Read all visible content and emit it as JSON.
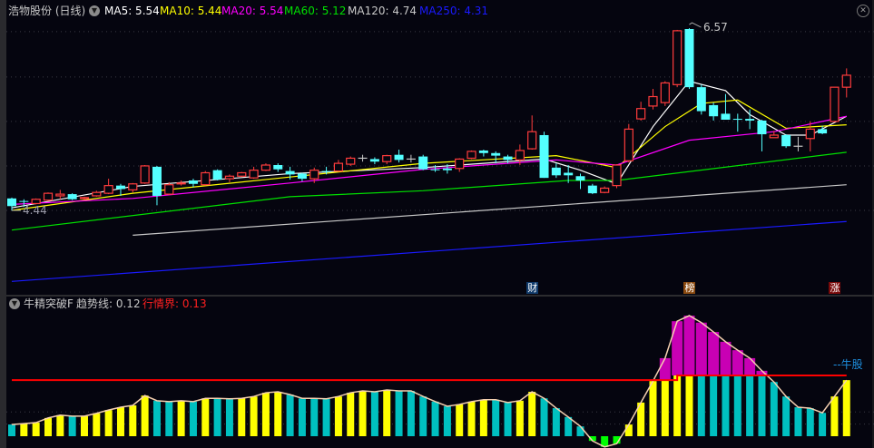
{
  "header": {
    "title": "浩物股份 (日线)",
    "ma": [
      {
        "label": "MA5: 5.54",
        "color": "#ffffff"
      },
      {
        "label": "MA10: 5.44",
        "color": "#ffff00"
      },
      {
        "label": "MA20: 5.54",
        "color": "#ff00ff"
      },
      {
        "label": "MA60: 5.12",
        "color": "#00e000"
      },
      {
        "label": "MA120: 4.74",
        "color": "#c8c8c8"
      },
      {
        "label": "MA250: 4.31",
        "color": "#1a1aff"
      }
    ]
  },
  "indicator_header": {
    "name": "牛精突破F",
    "trend_label": "趋势线: 0.12",
    "market_label": "行情界: 0.13"
  },
  "badges": [
    {
      "label": "财",
      "index": 43,
      "color": "#103a6a"
    },
    {
      "label": "榜",
      "index": 56,
      "color": "#8a4a10"
    },
    {
      "label": "涨",
      "index": 68,
      "color": "#7a0a0a"
    }
  ],
  "annotations": {
    "high_label": "6.57",
    "low_label": "4.44",
    "bull_label": "--牛股"
  },
  "icons": {
    "chevron": "chevron-down-icon",
    "close": "close-icon"
  },
  "chart_data": [
    {
      "type": "candlestick",
      "title": "浩物股份 (日线)",
      "ylim": [
        3.55,
        6.65
      ],
      "grid_prices": [
        4.44,
        4.96,
        5.48,
        6.0,
        6.53
      ],
      "ohlc": [
        [
          4.58,
          4.59,
          4.44,
          4.49
        ],
        [
          4.55,
          4.57,
          4.48,
          4.54
        ],
        [
          4.52,
          4.58,
          4.51,
          4.57
        ],
        [
          4.56,
          4.65,
          4.55,
          4.64
        ],
        [
          4.61,
          4.68,
          4.57,
          4.63
        ],
        [
          4.63,
          4.64,
          4.56,
          4.57
        ],
        [
          4.58,
          4.6,
          4.56,
          4.59
        ],
        [
          4.61,
          4.67,
          4.6,
          4.65
        ],
        [
          4.64,
          4.81,
          4.63,
          4.73
        ],
        [
          4.73,
          4.75,
          4.61,
          4.69
        ],
        [
          4.68,
          4.76,
          4.65,
          4.75
        ],
        [
          4.76,
          4.97,
          4.75,
          4.96
        ],
        [
          4.95,
          4.96,
          4.5,
          4.61
        ],
        [
          4.63,
          4.77,
          4.62,
          4.74
        ],
        [
          4.75,
          4.79,
          4.73,
          4.76
        ],
        [
          4.79,
          4.81,
          4.71,
          4.75
        ],
        [
          4.74,
          4.9,
          4.73,
          4.88
        ],
        [
          4.91,
          4.92,
          4.79,
          4.8
        ],
        [
          4.81,
          4.86,
          4.77,
          4.84
        ],
        [
          4.84,
          4.89,
          4.83,
          4.88
        ],
        [
          4.82,
          4.95,
          4.81,
          4.91
        ],
        [
          4.91,
          4.99,
          4.9,
          4.97
        ],
        [
          4.97,
          4.99,
          4.89,
          4.92
        ],
        [
          4.9,
          4.95,
          4.8,
          4.86
        ],
        [
          4.87,
          4.88,
          4.78,
          4.81
        ],
        [
          4.81,
          4.94,
          4.76,
          4.91
        ],
        [
          4.9,
          4.95,
          4.86,
          4.89
        ],
        [
          4.9,
          5.03,
          4.89,
          4.99
        ],
        [
          4.98,
          5.07,
          4.96,
          5.05
        ],
        [
          5.05,
          5.09,
          5.01,
          5.05
        ],
        [
          5.04,
          5.06,
          4.98,
          5.01
        ],
        [
          5.01,
          5.09,
          4.98,
          5.08
        ],
        [
          5.09,
          5.15,
          5.0,
          5.03
        ],
        [
          5.04,
          5.09,
          5.0,
          5.04
        ],
        [
          5.07,
          5.09,
          4.91,
          4.92
        ],
        [
          4.92,
          4.97,
          4.89,
          4.91
        ],
        [
          4.93,
          4.98,
          4.87,
          4.91
        ],
        [
          4.93,
          5.05,
          4.89,
          5.04
        ],
        [
          5.05,
          5.14,
          5.04,
          5.13
        ],
        [
          5.14,
          5.15,
          5.07,
          5.11
        ],
        [
          5.11,
          5.13,
          4.99,
          5.08
        ],
        [
          5.07,
          5.09,
          4.99,
          5.03
        ],
        [
          5.03,
          5.21,
          4.97,
          5.14
        ],
        [
          5.16,
          5.55,
          5.15,
          5.36
        ],
        [
          5.32,
          5.36,
          4.82,
          4.82
        ],
        [
          4.94,
          4.99,
          4.82,
          4.85
        ],
        [
          4.88,
          4.97,
          4.76,
          4.85
        ],
        [
          4.84,
          4.87,
          4.69,
          4.79
        ],
        [
          4.73,
          4.75,
          4.63,
          4.64
        ],
        [
          4.65,
          4.72,
          4.64,
          4.7
        ],
        [
          4.73,
          4.98,
          4.7,
          4.97
        ],
        [
          5.02,
          5.45,
          5.0,
          5.39
        ],
        [
          5.51,
          5.71,
          5.49,
          5.63
        ],
        [
          5.66,
          5.86,
          5.62,
          5.77
        ],
        [
          5.7,
          5.95,
          5.66,
          5.93
        ],
        [
          5.91,
          6.55,
          5.88,
          6.54
        ],
        [
          6.56,
          6.57,
          5.86,
          5.88
        ],
        [
          5.88,
          5.91,
          5.56,
          5.6
        ],
        [
          5.67,
          5.7,
          5.49,
          5.54
        ],
        [
          5.57,
          5.8,
          5.5,
          5.5
        ],
        [
          5.51,
          5.57,
          5.36,
          5.5
        ],
        [
          5.51,
          5.62,
          5.39,
          5.49
        ],
        [
          5.49,
          5.5,
          5.13,
          5.33
        ],
        [
          5.29,
          5.37,
          5.29,
          5.32
        ],
        [
          5.32,
          5.33,
          5.17,
          5.19
        ],
        [
          5.19,
          5.3,
          5.13,
          5.19
        ],
        [
          5.28,
          5.48,
          5.13,
          5.39
        ],
        [
          5.39,
          5.43,
          5.33,
          5.34
        ],
        [
          5.48,
          5.88,
          5.47,
          5.88
        ],
        [
          5.88,
          6.1,
          5.76,
          6.02
        ]
      ],
      "high": {
        "index": 56,
        "value": 6.57
      },
      "low": {
        "index": 0,
        "value": 4.44
      },
      "moving_averages": [
        {
          "name": "MA5",
          "color": "#ffffff",
          "points": [
            [
              0,
              4.47
            ],
            [
              10,
              4.72
            ],
            [
              23,
              4.87
            ],
            [
              34,
              4.94
            ],
            [
              44,
              5.04
            ],
            [
              47,
              4.91
            ],
            [
              50,
              4.75
            ],
            [
              53,
              5.42
            ],
            [
              56,
              5.95
            ],
            [
              59,
              5.84
            ],
            [
              61,
              5.56
            ],
            [
              64,
              5.32
            ],
            [
              66,
              5.32
            ],
            [
              69,
              5.54
            ]
          ]
        },
        {
          "name": "MA10",
          "color": "#ffff00",
          "points": [
            [
              0,
              4.44
            ],
            [
              10,
              4.64
            ],
            [
              23,
              4.83
            ],
            [
              34,
              4.99
            ],
            [
              45,
              5.08
            ],
            [
              50,
              4.94
            ],
            [
              54,
              5.42
            ],
            [
              57,
              5.69
            ],
            [
              60,
              5.73
            ],
            [
              64,
              5.4
            ],
            [
              69,
              5.44
            ]
          ]
        },
        {
          "name": "MA20",
          "color": "#ff00ff",
          "points": [
            [
              0,
              4.51
            ],
            [
              10,
              4.58
            ],
            [
              23,
              4.76
            ],
            [
              34,
              4.92
            ],
            [
              45,
              5.03
            ],
            [
              50,
              4.97
            ],
            [
              56,
              5.26
            ],
            [
              63,
              5.36
            ],
            [
              69,
              5.54
            ]
          ]
        },
        {
          "name": "MA60",
          "color": "#00e000",
          "points": [
            [
              0,
              4.21
            ],
            [
              23,
              4.6
            ],
            [
              34,
              4.67
            ],
            [
              46,
              4.79
            ],
            [
              50,
              4.79
            ],
            [
              69,
              5.12
            ]
          ]
        },
        {
          "name": "MA120",
          "color": "#c8c8c8",
          "points": [
            [
              10,
              4.15
            ],
            [
              69,
              4.74
            ]
          ]
        },
        {
          "name": "MA250",
          "color": "#1a1aff",
          "points": [
            [
              0,
              3.61
            ],
            [
              69,
              4.31
            ]
          ]
        }
      ]
    },
    {
      "type": "bar",
      "title": "牛精突破F",
      "ylim": [
        -0.03,
        0.27
      ],
      "values": [
        0.025,
        0.027,
        0.029,
        0.039,
        0.045,
        0.043,
        0.043,
        0.049,
        0.056,
        0.062,
        0.066,
        0.087,
        0.076,
        0.074,
        0.076,
        0.074,
        0.081,
        0.081,
        0.08,
        0.081,
        0.085,
        0.093,
        0.095,
        0.089,
        0.081,
        0.081,
        0.08,
        0.085,
        0.093,
        0.097,
        0.095,
        0.099,
        0.097,
        0.097,
        0.085,
        0.074,
        0.064,
        0.068,
        0.074,
        0.078,
        0.078,
        0.072,
        0.076,
        0.095,
        0.081,
        0.06,
        0.041,
        0.021,
        -0.01,
        -0.023,
        -0.016,
        0.025,
        0.072,
        0.118,
        0.167,
        0.246,
        0.258,
        0.243,
        0.223,
        0.202,
        0.184,
        0.167,
        0.14,
        0.116,
        0.085,
        0.062,
        0.06,
        0.05,
        0.085,
        0.12
      ],
      "colors": [
        "c",
        "y",
        "y",
        "y",
        "y",
        "c",
        "y",
        "y",
        "y",
        "y",
        "y",
        "y",
        "c",
        "c",
        "y",
        "c",
        "y",
        "c",
        "c",
        "y",
        "y",
        "y",
        "y",
        "c",
        "c",
        "c",
        "c",
        "y",
        "y",
        "y",
        "c",
        "y",
        "c",
        "c",
        "c",
        "c",
        "c",
        "y",
        "y",
        "y",
        "c",
        "c",
        "y",
        "y",
        "c",
        "c",
        "c",
        "c",
        "g",
        "g",
        "g",
        "y",
        "y",
        "y",
        "y",
        "y",
        "y",
        "c",
        "c",
        "c",
        "c",
        "c",
        "c",
        "c",
        "c",
        "c",
        "c",
        "c",
        "y",
        "y"
      ],
      "color_map": {
        "y": "#ffff00",
        "c": "#00c0c0",
        "g": "#00ff00",
        "above": "#c800b4",
        "trend": "#f5d0b0",
        "line": "#ff0000"
      },
      "line_levels": [
        {
          "from": 0,
          "to": 55,
          "value": 0.12
        },
        {
          "from": 55,
          "to": 69,
          "value": 0.13
        }
      ],
      "grid_values": [
        0.026,
        0.052
      ]
    }
  ]
}
